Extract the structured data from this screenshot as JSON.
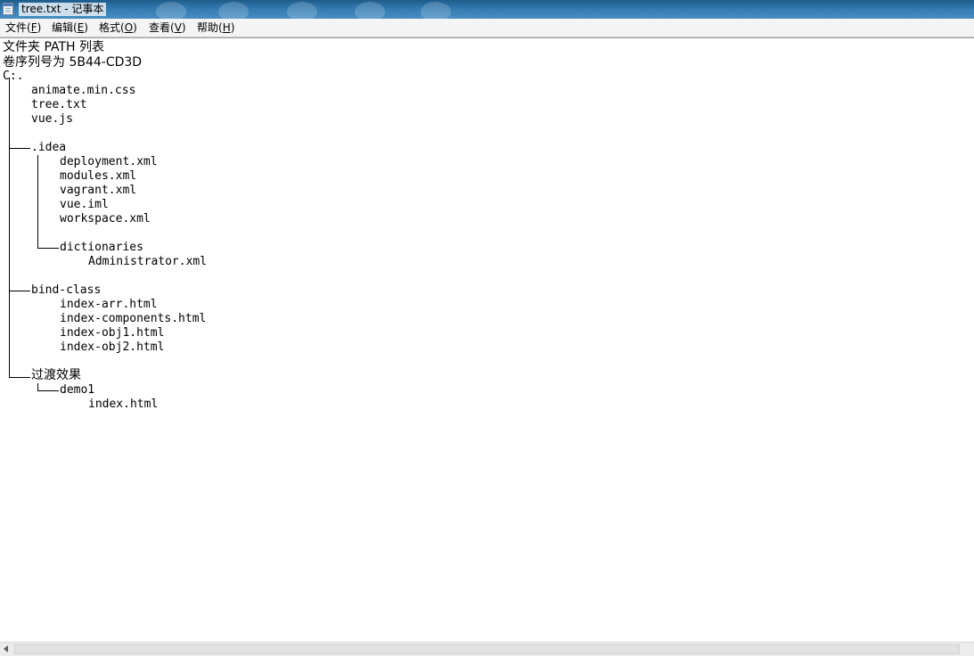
{
  "window": {
    "title": "tree.txt - 记事本",
    "app_icon": "notepad-icon"
  },
  "menubar": {
    "items": [
      {
        "label": "文件(",
        "accel": "F",
        "suffix": ")"
      },
      {
        "label": "编辑(",
        "accel": "E",
        "suffix": ")"
      },
      {
        "label": "格式(",
        "accel": "O",
        "suffix": ")"
      },
      {
        "label": "查看(",
        "accel": "V",
        "suffix": ")"
      },
      {
        "label": "帮助(",
        "accel": "H",
        "suffix": ")"
      }
    ]
  },
  "document": {
    "header": [
      "文件夹 PATH 列表",
      "卷序列号为 5B44-CD3D"
    ],
    "root": "C:.",
    "root_files": [
      "animate.min.css",
      "tree.txt",
      "vue.js"
    ],
    "idea": {
      "name": ".idea",
      "files": [
        "deployment.xml",
        "modules.xml",
        "vagrant.xml",
        "vue.iml",
        "workspace.xml"
      ],
      "dictionaries": {
        "name": "dictionaries",
        "files": [
          "Administrator.xml"
        ]
      }
    },
    "bind_class": {
      "name": "bind-class",
      "files": [
        "index-arr.html",
        "index-components.html",
        "index-obj1.html",
        "index-obj2.html"
      ]
    },
    "transition": {
      "name": "过渡效果",
      "demo": {
        "name": "demo1",
        "files": [
          "index.html"
        ]
      }
    }
  },
  "scrollbar": {
    "left_arrow": "scroll-left-arrow-icon"
  }
}
